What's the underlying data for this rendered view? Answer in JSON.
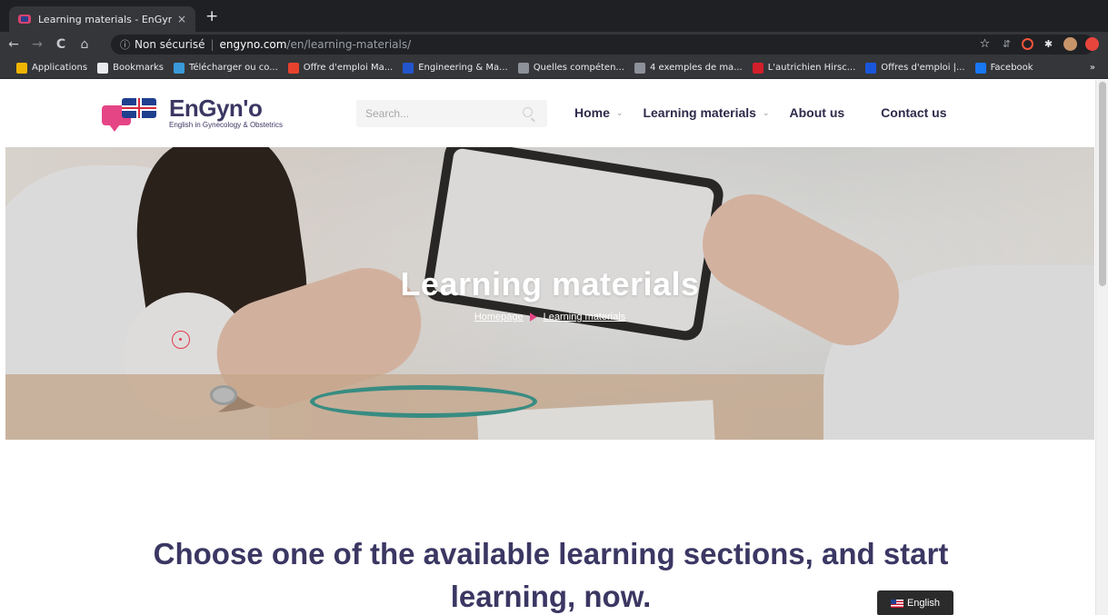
{
  "browser": {
    "tab": {
      "title": "Learning materials - EnGyn'O",
      "close_glyph": "×",
      "new_tab_glyph": "+"
    },
    "nav": {
      "back": "←",
      "forward": "→",
      "reload": "C",
      "home": "⌂"
    },
    "address": {
      "security_label": "Non sécurisé",
      "host": "engyno.com",
      "path": "/en/learning-materials/"
    },
    "extensions": [
      "star-icon",
      "extension-icon",
      "opera-icon",
      "puzzle-icon",
      "profile-avatar",
      "record-icon"
    ],
    "bookmarks": [
      {
        "label": "Applications",
        "icon": "apps-grid-icon",
        "color": "#f0b400"
      },
      {
        "label": "Bookmarks",
        "icon": "star-icon",
        "color": "#e8eaed"
      },
      {
        "label": "Télécharger ou co...",
        "icon": "download-site-icon",
        "color": "#3a9ad9"
      },
      {
        "label": "Offre d'emploi Ma...",
        "icon": "job-site-icon",
        "color": "#e8422f"
      },
      {
        "label": "Engineering & Ma...",
        "icon": "mp-site-icon",
        "color": "#2255cc"
      },
      {
        "label": "Quelles compéten...",
        "icon": "skills-site-icon",
        "color": "#8d9199"
      },
      {
        "label": "4 exemples de ma...",
        "icon": "examples-site-icon",
        "color": "#8d9199"
      },
      {
        "label": "L'autrichien Hirsc...",
        "icon": "un-site-icon",
        "color": "#d21f2b"
      },
      {
        "label": "Offres d'emploi |...",
        "icon": "p-site-icon",
        "color": "#1a56db"
      },
      {
        "label": "Facebook",
        "icon": "facebook-icon",
        "color": "#1877f2"
      }
    ],
    "bookmarks_overflow": "»"
  },
  "site": {
    "logo": {
      "title": "EnGyn'o",
      "subtitle": "English in Gynecology & Obstetrics"
    },
    "search": {
      "placeholder": "Search..."
    },
    "nav": [
      {
        "label": "Home",
        "has_dropdown": true
      },
      {
        "label": "Learning materials",
        "has_dropdown": true
      },
      {
        "label": "About us",
        "has_dropdown": false
      },
      {
        "label": "Contact us",
        "has_dropdown": false
      }
    ],
    "hero": {
      "title": "Learning materials",
      "breadcrumb": {
        "home": "Homepage",
        "current": "Learning materials"
      }
    },
    "section_heading_line1": "Choose one of the available learning sections, and start",
    "section_heading_line2": "learning, now.",
    "language_switcher": {
      "label": "English"
    },
    "colors": {
      "brand_dark": "#3b3763",
      "brand_pink": "#e54584",
      "chrome_dark": "#35363a"
    }
  }
}
